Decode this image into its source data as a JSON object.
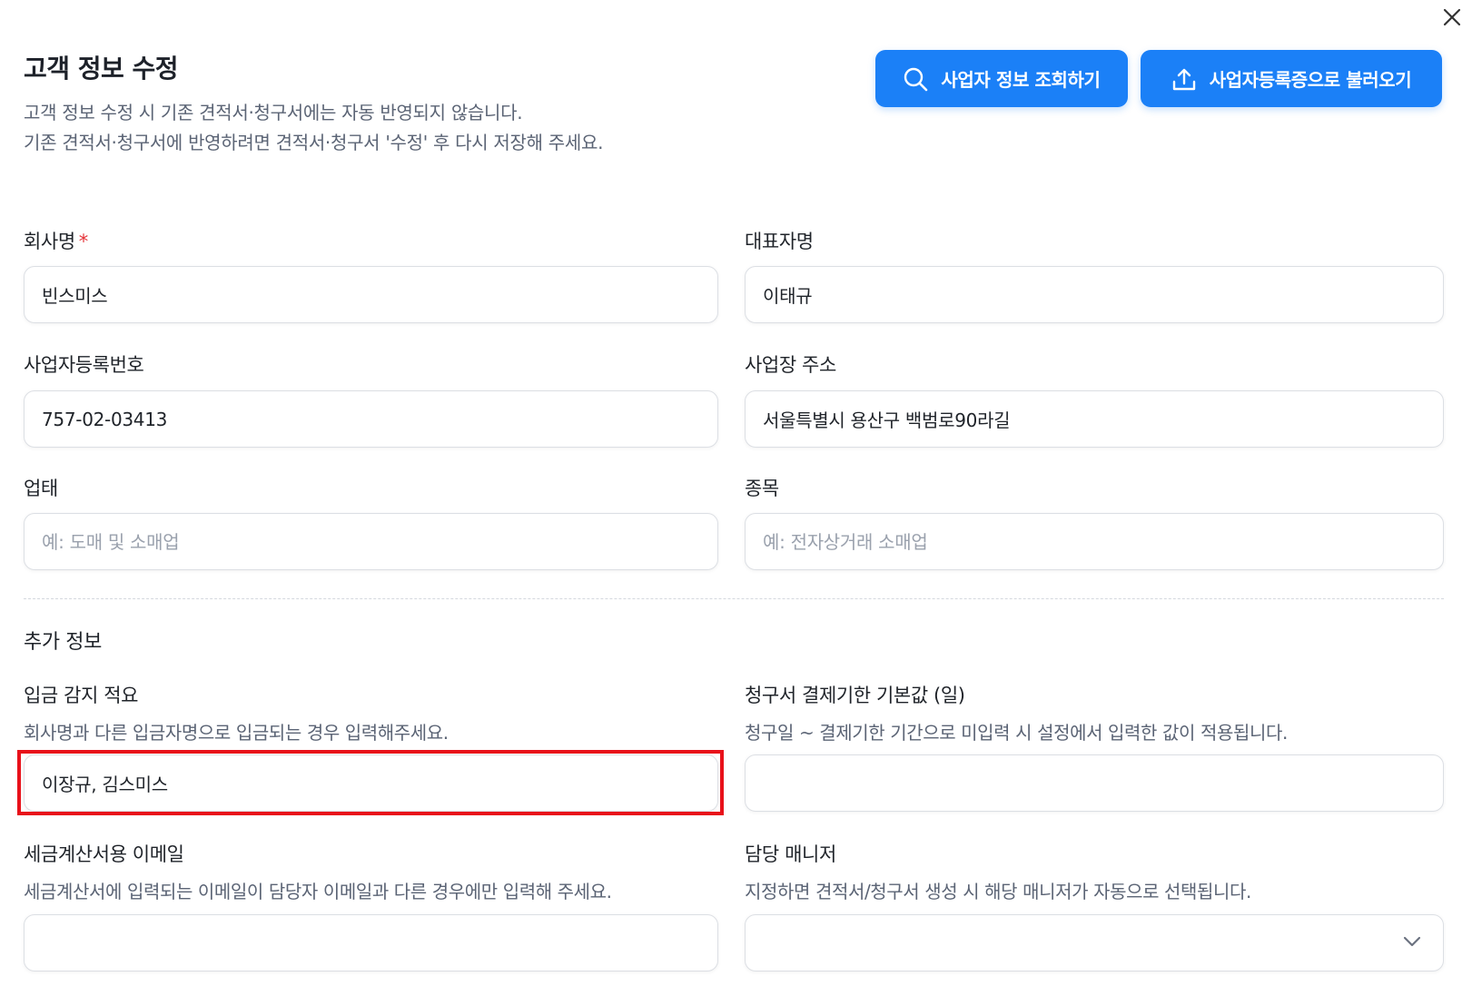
{
  "dialog": {
    "title": "고객 정보 수정",
    "description_line1": "고객 정보 수정 시 기존 견적서·청구서에는 자동 반영되지 않습니다.",
    "description_line2": "기존 견적서·청구서에 반영하려면 견적서·청구서 '수정' 후 다시 저장해 주세요.",
    "close_icon": "close-icon"
  },
  "actions": {
    "lookup_button": {
      "label": "사업자 정보 조회하기",
      "icon": "search-icon"
    },
    "import_button": {
      "label": "사업자등록증으로 불러오기",
      "icon": "upload-icon"
    }
  },
  "colors": {
    "primary": "#1b80f7",
    "required": "#e5343a",
    "highlight": "#e8111a"
  },
  "form": {
    "company_name": {
      "label": "회사명",
      "required_mark": "*",
      "value": "빈스미스"
    },
    "representative": {
      "label": "대표자명",
      "value": "이태규"
    },
    "business_number": {
      "label": "사업자등록번호",
      "value": "757-02-03413"
    },
    "business_address": {
      "label": "사업장 주소",
      "value": "서울특별시 용산구 백범로90라길"
    },
    "business_type": {
      "label": "업태",
      "value": "",
      "placeholder": "예: 도매 및 소매업"
    },
    "business_item": {
      "label": "종목",
      "value": "",
      "placeholder": "예: 전자상거래 소매업"
    }
  },
  "additional": {
    "section_title": "추가 정보",
    "deposit_memo": {
      "label": "입금 감지 적요",
      "help": "회사명과 다른 입금자명으로 입금되는 경우 입력해주세요.",
      "value": "이장규, 김스미스"
    },
    "payment_due_default": {
      "label": "청구서 결제기한 기본값 (일)",
      "help": "청구일 ~ 결제기한 기간으로 미입력 시 설정에서 입력한 값이 적용됩니다.",
      "value": ""
    },
    "tax_invoice_email": {
      "label": "세금계산서용 이메일",
      "help": "세금계산서에 입력되는 이메일이 담당자 이메일과 다른 경우에만 입력해 주세요.",
      "value": ""
    },
    "manager": {
      "label": "담당 매니저",
      "help": "지정하면 견적서/청구서 생성 시 해당 매니저가 자동으로 선택됩니다.",
      "selected": "",
      "icon": "chevron-down-icon"
    }
  }
}
